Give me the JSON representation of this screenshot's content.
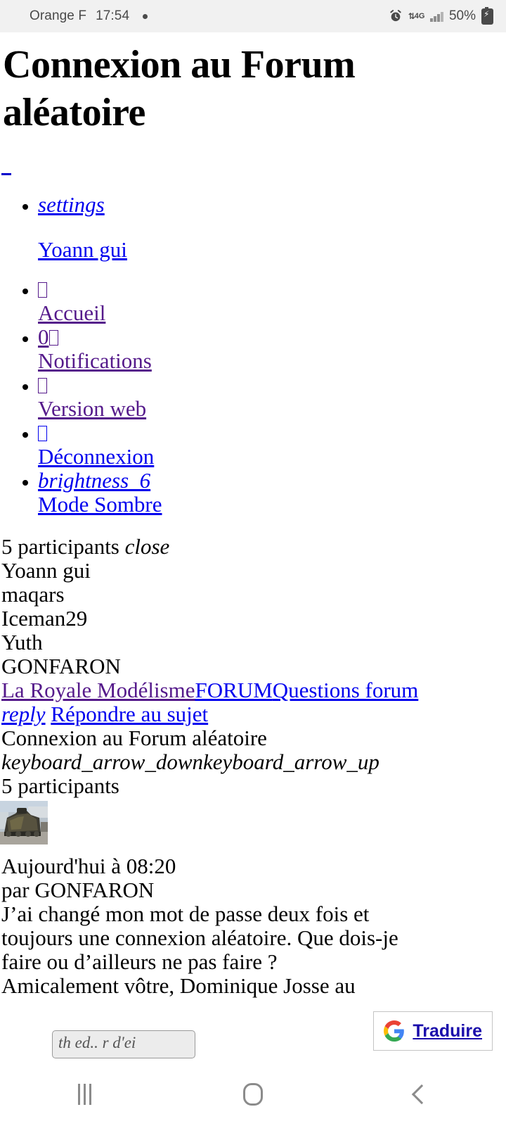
{
  "status_bar": {
    "carrier": "Orange F",
    "time": "17:54",
    "alarm_icon": "alarm-icon",
    "network": "4G",
    "network_arrows": "↕",
    "signal_icon": "signal-bars-icon",
    "battery_percent": "50%",
    "battery_icon": "battery-charging-icon"
  },
  "page": {
    "title": "Connexion au Forum aléatoire",
    "empty_link": ""
  },
  "user_menu": {
    "settings_icon_label": "settings",
    "username": "Yoann gui"
  },
  "nav_items": [
    {
      "icon": "home-icon",
      "icon_glyph": "",
      "badge": "",
      "label": "Accueil",
      "state": "visited"
    },
    {
      "icon": "notifications-icon",
      "icon_glyph": "",
      "badge": "0",
      "label": "Notifications",
      "state": "visited"
    },
    {
      "icon": "desktop-icon",
      "icon_glyph": "",
      "badge": "",
      "label": "Version web",
      "state": "visited"
    },
    {
      "icon": "logout-icon",
      "icon_glyph": "",
      "badge": "",
      "label": "Déconnexion",
      "state": "unvisited"
    },
    {
      "icon": "brightness-icon",
      "icon_glyph": "brightness_6",
      "badge": "",
      "label": "Mode Sombre",
      "state": "unvisited"
    }
  ],
  "participants_panel": {
    "count_label": "5 participants",
    "close_label": "close",
    "names": [
      "Yoann gui",
      "maqars",
      "Iceman29",
      "Yuth",
      "GONFARON"
    ]
  },
  "breadcrumb": [
    {
      "label": "La Royale Modélisme",
      "state": "visited"
    },
    {
      "label": "FORUM",
      "state": "unvisited"
    },
    {
      "label": "Questions forum",
      "state": "unvisited"
    }
  ],
  "reply_bar": {
    "icon_label": "reply",
    "label": "Répondre au sujet"
  },
  "topic": {
    "title": "Connexion au Forum aléatoire",
    "collapse_icon": "keyboard_arrow_down",
    "expand_icon": "keyboard_arrow_up",
    "participants_label": "5 participants"
  },
  "post": {
    "avatar": "user-avatar-tank-photo",
    "date": "Aujourd'hui à 08:20",
    "author_prefix": "par GONFARON",
    "body_lines": [
      "J’ai changé mon mot de passe deux fois et",
      "toujours une connexion aléatoire. Que dois-je",
      "faire ou d’ailleurs ne pas faire ?",
      "Amicalement vôtre, Dominique Josse au"
    ],
    "clipped_field_text": "th ed.. r d'ei"
  },
  "translate_chip": {
    "icon": "google-g-icon",
    "label": "Traduire"
  },
  "android_nav": {
    "recents": "recents-icon",
    "home": "home-icon",
    "back": "back-icon"
  },
  "colors": {
    "link_unvisited": "#0000ee",
    "link_visited": "#551a8b",
    "status_bg": "#f1f1f1",
    "translate_blue": "#1a0dab"
  }
}
